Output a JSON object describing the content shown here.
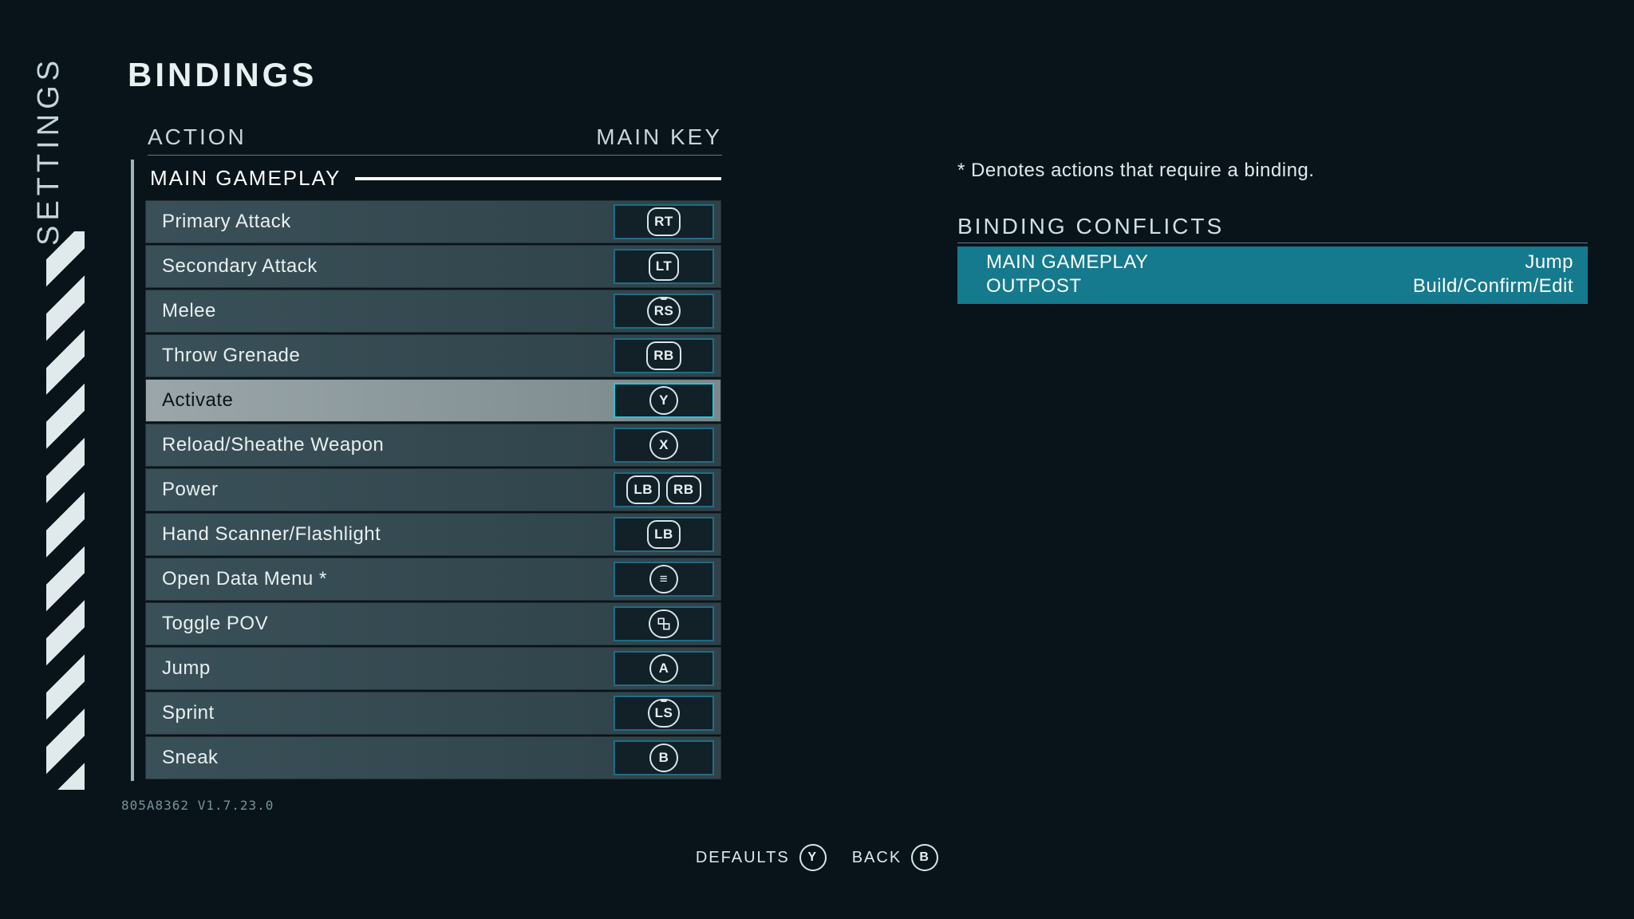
{
  "sidebar_label": "SETTINGS",
  "page_title": "BINDINGS",
  "columns": {
    "action": "ACTION",
    "main_key": "MAIN KEY"
  },
  "category": "MAIN GAMEPLAY",
  "rows": [
    {
      "action": "Primary Attack",
      "keys": [
        "RT"
      ],
      "kind": "pill",
      "selected": false
    },
    {
      "action": "Secondary Attack",
      "keys": [
        "LT"
      ],
      "kind": "pill",
      "selected": false
    },
    {
      "action": "Melee",
      "keys": [
        "RS"
      ],
      "kind": "click",
      "selected": false
    },
    {
      "action": "Throw Grenade",
      "keys": [
        "RB"
      ],
      "kind": "pill",
      "selected": false
    },
    {
      "action": "Activate",
      "keys": [
        "Y"
      ],
      "kind": "round",
      "selected": true
    },
    {
      "action": "Reload/Sheathe Weapon",
      "keys": [
        "X"
      ],
      "kind": "round",
      "selected": false
    },
    {
      "action": "Power",
      "keys": [
        "LB",
        "RB"
      ],
      "kind": "pill",
      "selected": false
    },
    {
      "action": "Hand Scanner/Flashlight",
      "keys": [
        "LB"
      ],
      "kind": "pill",
      "selected": false
    },
    {
      "action": "Open Data Menu *",
      "keys": [
        "≡"
      ],
      "kind": "round",
      "selected": false
    },
    {
      "action": "Toggle POV",
      "keys": [
        "svg-pov"
      ],
      "kind": "round",
      "selected": false
    },
    {
      "action": "Jump",
      "keys": [
        "A"
      ],
      "kind": "round",
      "selected": false
    },
    {
      "action": "Sprint",
      "keys": [
        "LS"
      ],
      "kind": "click",
      "selected": false
    },
    {
      "action": "Sneak",
      "keys": [
        "B"
      ],
      "kind": "round",
      "selected": false
    }
  ],
  "note": "* Denotes actions that require a binding.",
  "conflicts_header": "BINDING CONFLICTS",
  "conflicts": [
    {
      "category": "MAIN GAMEPLAY",
      "action": "Jump"
    },
    {
      "category": "OUTPOST",
      "action": "Build/Confirm/Edit"
    }
  ],
  "version": "805A8362 V1.7.23.0",
  "footer": {
    "defaults": {
      "label": "DEFAULTS",
      "key": "Y"
    },
    "back": {
      "label": "BACK",
      "key": "B"
    }
  }
}
